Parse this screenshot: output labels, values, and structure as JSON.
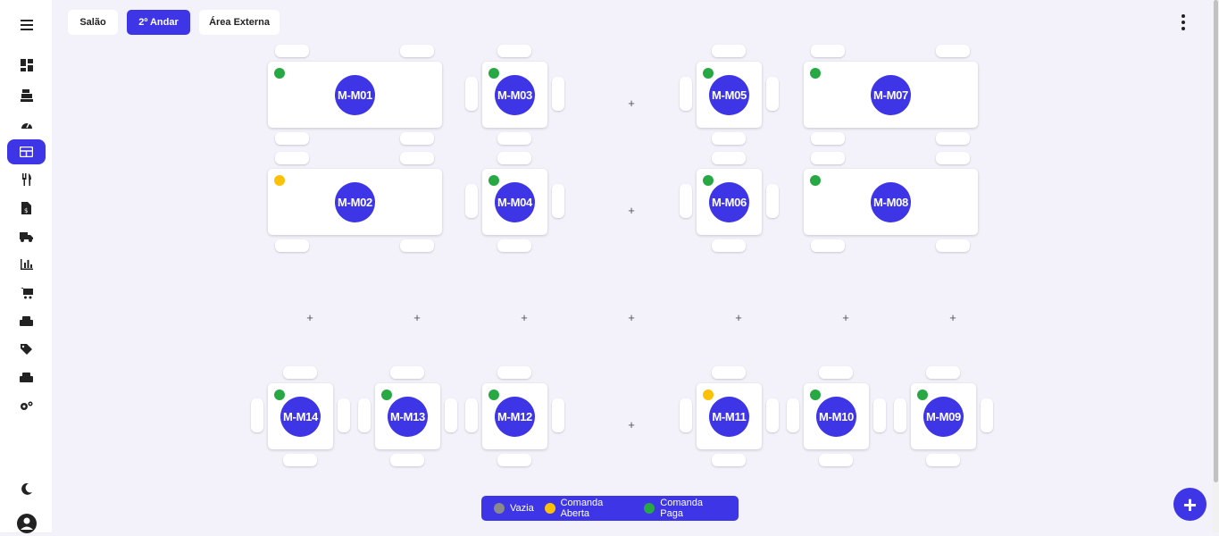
{
  "tabs": [
    {
      "label": "Salão"
    },
    {
      "label": "2º Andar"
    },
    {
      "label": "Área Externa"
    }
  ],
  "active_tab": "2º Andar",
  "sidebar": {
    "items": [
      "menu",
      "dashboard",
      "cash-register",
      "gauge",
      "tables",
      "utensils",
      "invoice",
      "delivery-truck",
      "bar-chart",
      "cart",
      "boxes",
      "tags",
      "boxes-2",
      "settings"
    ],
    "active": "tables",
    "bottom": [
      "dark-mode-moon",
      "user-avatar"
    ]
  },
  "tables": [
    {
      "label": "M-M01",
      "status": "Comanda Paga"
    },
    {
      "label": "M-M02",
      "status": "Comanda Aberta"
    },
    {
      "label": "M-M03",
      "status": "Comanda Paga"
    },
    {
      "label": "M-M04",
      "status": "Comanda Paga"
    },
    {
      "label": "M-M05",
      "status": "Comanda Paga"
    },
    {
      "label": "M-M06",
      "status": "Comanda Paga"
    },
    {
      "label": "M-M07",
      "status": "Comanda Paga"
    },
    {
      "label": "M-M08",
      "status": "Comanda Paga"
    },
    {
      "label": "M-M09",
      "status": "Comanda Paga"
    },
    {
      "label": "M-M10",
      "status": "Comanda Paga"
    },
    {
      "label": "M-M11",
      "status": "Comanda Aberta"
    },
    {
      "label": "M-M12",
      "status": "Comanda Paga"
    },
    {
      "label": "M-M13",
      "status": "Comanda Paga"
    },
    {
      "label": "M-M14",
      "status": "Comanda Paga"
    }
  ],
  "empty_slot_symbol": "+",
  "legend": [
    {
      "label": "Vazia",
      "color": "#8a8a8a"
    },
    {
      "label": "Comanda Aberta",
      "color": "#ffc107"
    },
    {
      "label": "Comanda Paga",
      "color": "#28a745"
    }
  ],
  "status_colors": {
    "Vazia": "#8a8a8a",
    "Comanda Aberta": "#ffc107",
    "Comanda Paga": "#28a745"
  },
  "accent": "#3d35e6",
  "fab_symbol": "+"
}
